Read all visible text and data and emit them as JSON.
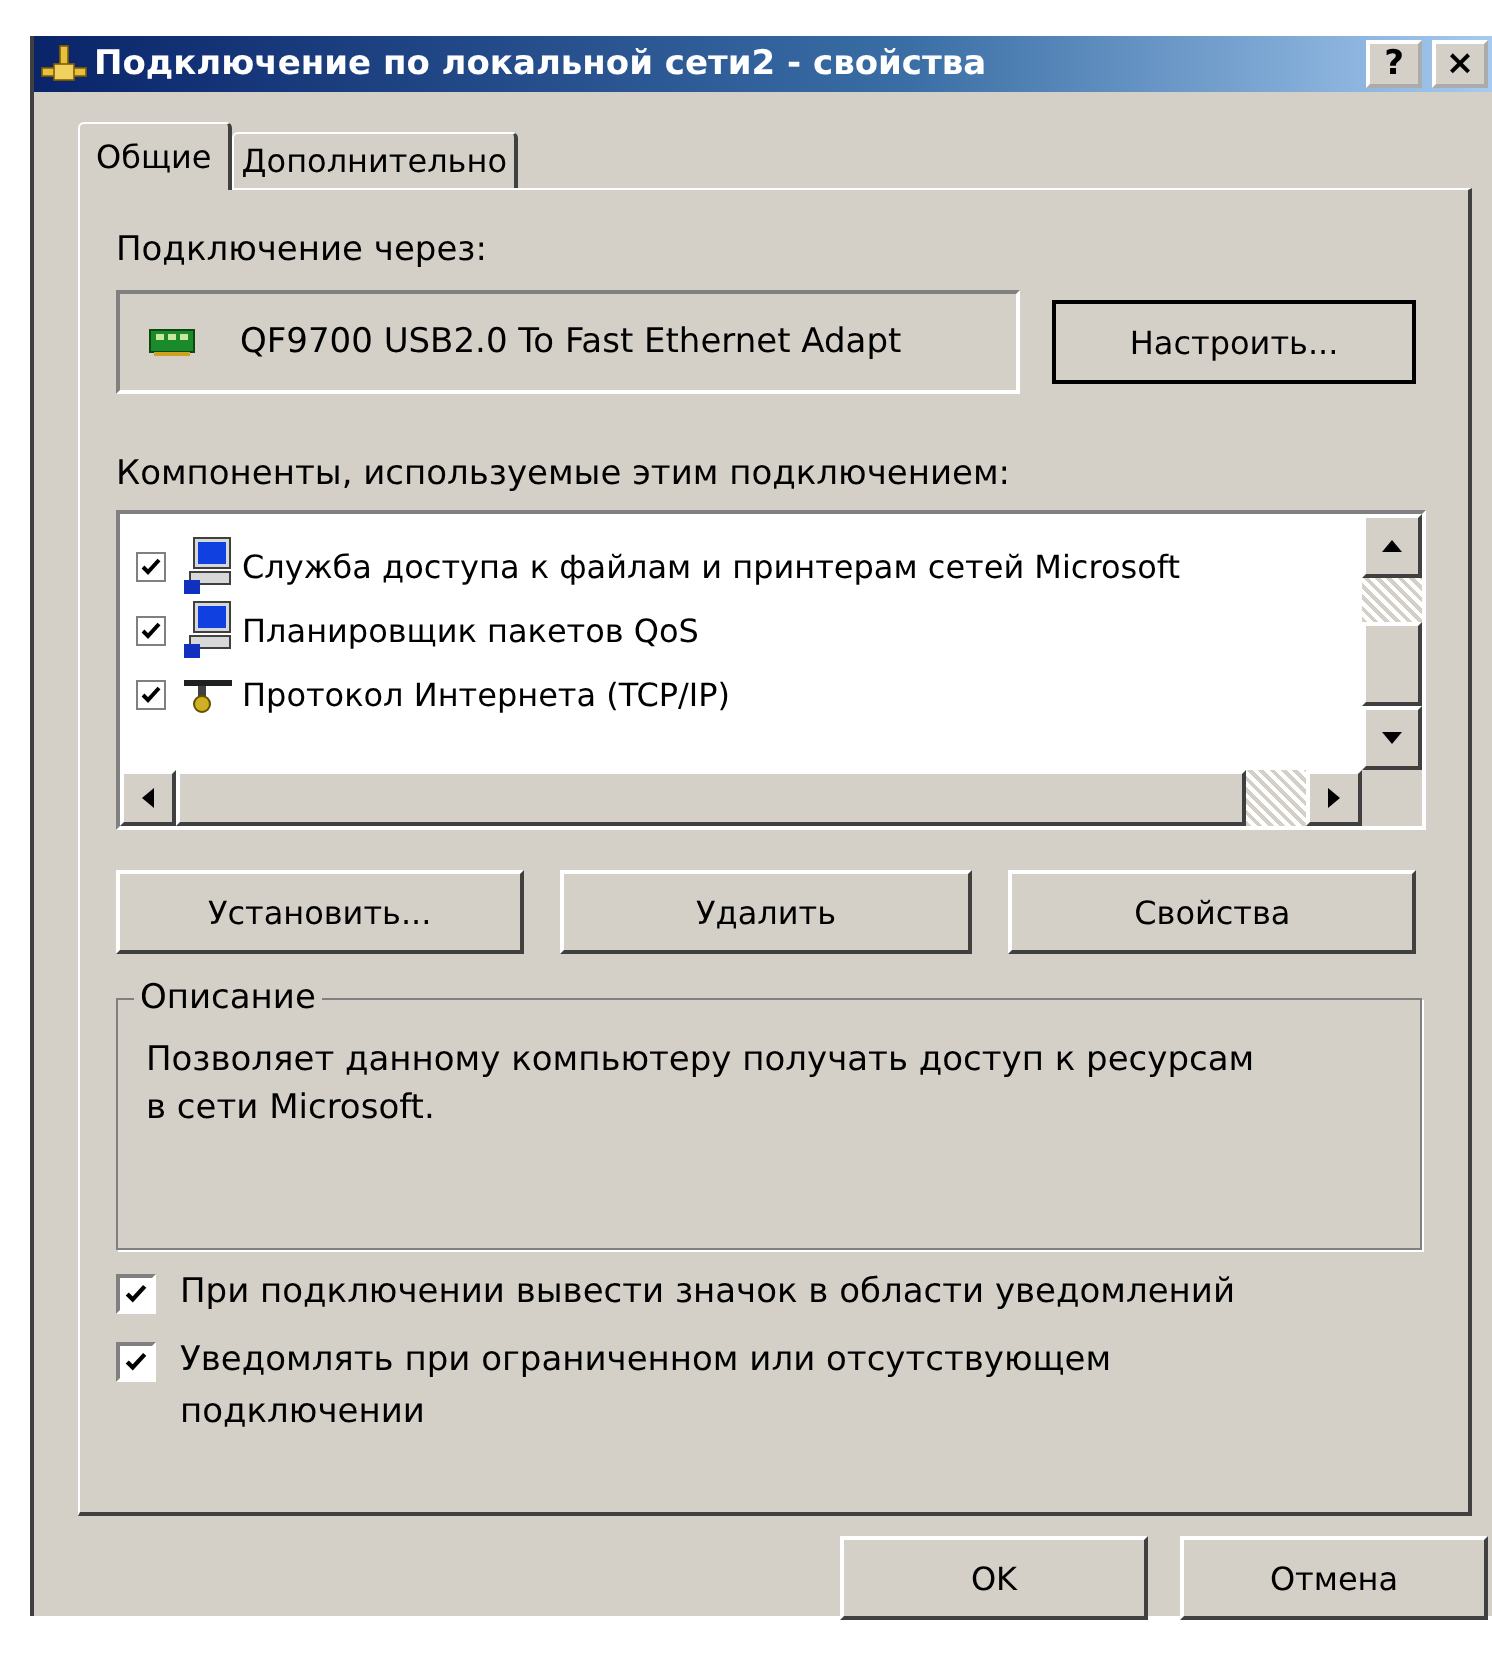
{
  "window": {
    "title": "Подключение по локальной сети2 - свойства",
    "help_button": "?",
    "close_button": "×"
  },
  "tabs": [
    {
      "label": "Общие",
      "selected": true
    },
    {
      "label": "Дополнительно",
      "selected": false
    }
  ],
  "connect_using": {
    "label": "Подключение через:",
    "adapter": "QF9700 USB2.0 To Fast Ethernet Adapt",
    "configure_button": "Настроить..."
  },
  "components": {
    "label": "Компоненты, используемые этим подключением:",
    "items": [
      {
        "kind": "computer",
        "name": "Служба доступа к файлам и принтерам сетей Microsoft",
        "checked": true
      },
      {
        "kind": "computer",
        "name": "Планировщик пакетов QoS",
        "checked": true
      },
      {
        "kind": "protocol",
        "name": "Протокол Интернета (TCP/IP)",
        "checked": true
      }
    ]
  },
  "component_buttons": [
    "Установить...",
    "Удалить",
    "Свойства"
  ],
  "description": {
    "legend": "Описание",
    "text": "Позволяет данному компьютеру получать доступ к ресурсам в сети Microsoft."
  },
  "options": [
    {
      "label": "При подключении вывести значок в области уведомлений",
      "checked": true
    },
    {
      "label": "Уведомлять при ограниченном или отсутствующем подключении",
      "checked": true
    }
  ],
  "buttons": [
    "OK",
    "Отмена"
  ]
}
